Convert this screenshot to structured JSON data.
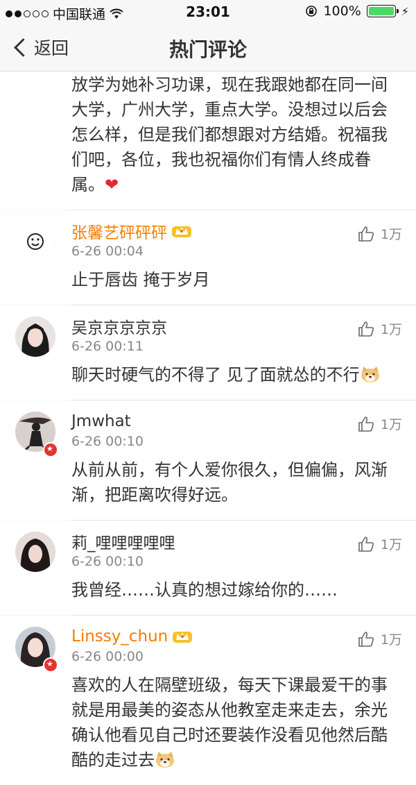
{
  "status": {
    "carrier": "中国联通",
    "time": "23:01",
    "battery": "100%",
    "signal_bars": 2
  },
  "nav": {
    "back_label": "返回",
    "title": "热门评论"
  },
  "first_comment_tail": "放学为她补习功课，现在我跟她都在同一间大学，广州大学，重点大学。没想过以后会怎么样，但是我们都想跟对方结婚。祝福我们吧，各位，我也祝福你们有情人终成眷属。",
  "comments": [
    {
      "name": "张馨艺砰砰砰",
      "vip": true,
      "date": "6-26 00:04",
      "likes": "1万",
      "text": "止于唇齿 掩于岁月",
      "avatar": "smiley-icon",
      "badge": false,
      "emoji": false
    },
    {
      "name": "吴京京京京京",
      "vip": false,
      "date": "6-26 00:11",
      "likes": "1万",
      "text": "聊天时硬气的不得了 见了面就怂的不行",
      "avatar": "girl-portrait",
      "badge": false,
      "emoji": true
    },
    {
      "name": "Jmwhat",
      "vip": false,
      "date": "6-26 00:10",
      "likes": "1万",
      "text": "从前从前，有个人爱你很久，但偏偏，风渐渐，把距离吹得好远。",
      "avatar": "silhouette",
      "badge": true,
      "emoji": false
    },
    {
      "name": "莉_哩哩哩哩哩",
      "vip": false,
      "date": "6-26 00:10",
      "likes": "1万",
      "text": "我曾经……认真的想过嫁给你的……",
      "avatar": "girl-portrait-2",
      "badge": false,
      "emoji": false
    },
    {
      "name": "Linssy_chun",
      "vip": true,
      "date": "6-26 00:00",
      "likes": "1万",
      "text": "喜欢的人在隔壁班级，每天下课最爱干的事就是用最美的姿态从他教室走来走去，余光确认他看见自己时还要装作没看见他然后酷酷的走过去",
      "avatar": "girl-portrait-3",
      "badge": true,
      "emoji": true
    }
  ],
  "colors": {
    "vip_name": "#f57c00",
    "badge": "#e3352c",
    "heart": "#e82633"
  }
}
